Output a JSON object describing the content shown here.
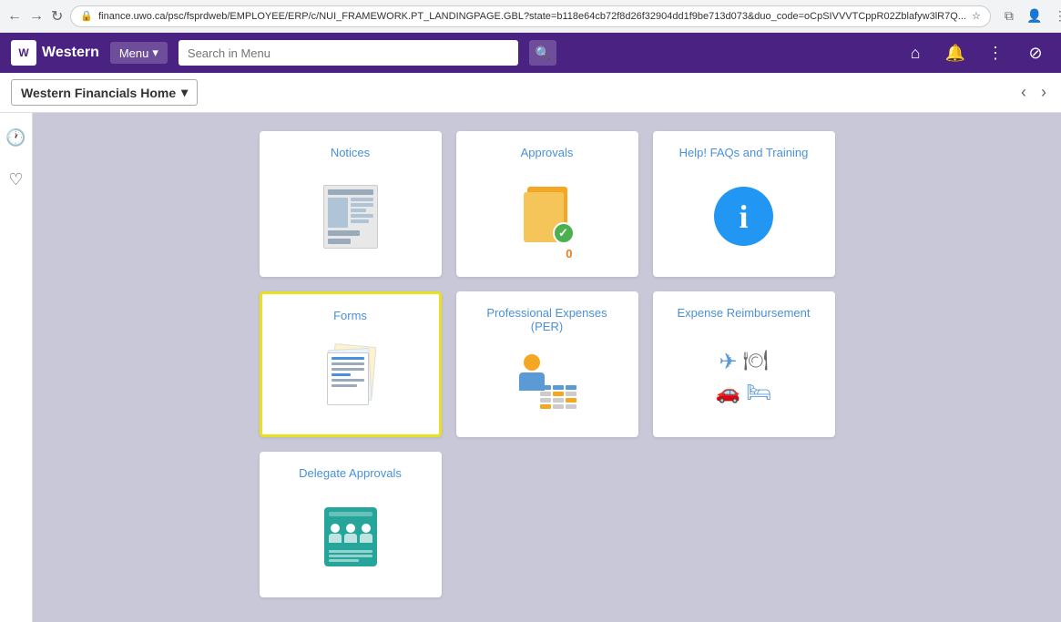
{
  "browser": {
    "url": "finance.uwo.ca/psc/fsprdweb/EMPLOYEE/ERP/c/NUI_FRAMEWORK.PT_LANDINGPAGE.GBL?state=b118e64cb72f8d26f32904dd1f9be713d073&duo_code=oCpSIVVVTCppR02Zblafyw3lR7Q...",
    "back_disabled": false,
    "forward_disabled": false
  },
  "header": {
    "logo_text": "Western",
    "menu_label": "Menu",
    "menu_arrow": "▾",
    "search_placeholder": "Search in Menu",
    "home_icon": "⌂",
    "bell_icon": "🔔",
    "more_icon": "⋮",
    "no_icon": "⊘"
  },
  "subheader": {
    "breadcrumb_label": "Western Financials Home",
    "dropdown_arrow": "▾",
    "prev_arrow": "‹",
    "next_arrow": "›"
  },
  "sidebar": {
    "clock_icon": "🕐",
    "heart_icon": "♡"
  },
  "tiles": [
    {
      "id": "notices",
      "title": "Notices",
      "highlighted": false,
      "badge": ""
    },
    {
      "id": "approvals",
      "title": "Approvals",
      "highlighted": false,
      "badge": "0"
    },
    {
      "id": "help",
      "title": "Help! FAQs and Training",
      "highlighted": false,
      "badge": ""
    },
    {
      "id": "forms",
      "title": "Forms",
      "highlighted": true,
      "badge": ""
    },
    {
      "id": "per",
      "title": "Professional Expenses (PER)",
      "highlighted": false,
      "badge": ""
    },
    {
      "id": "expense",
      "title": "Expense Reimbursement",
      "highlighted": false,
      "badge": ""
    },
    {
      "id": "delegate",
      "title": "Delegate Approvals",
      "highlighted": false,
      "badge": ""
    }
  ],
  "colors": {
    "purple": "#4a2282",
    "link_blue": "#4a90d9",
    "highlight_yellow": "#e8e020",
    "badge_orange": "#e87c20"
  }
}
